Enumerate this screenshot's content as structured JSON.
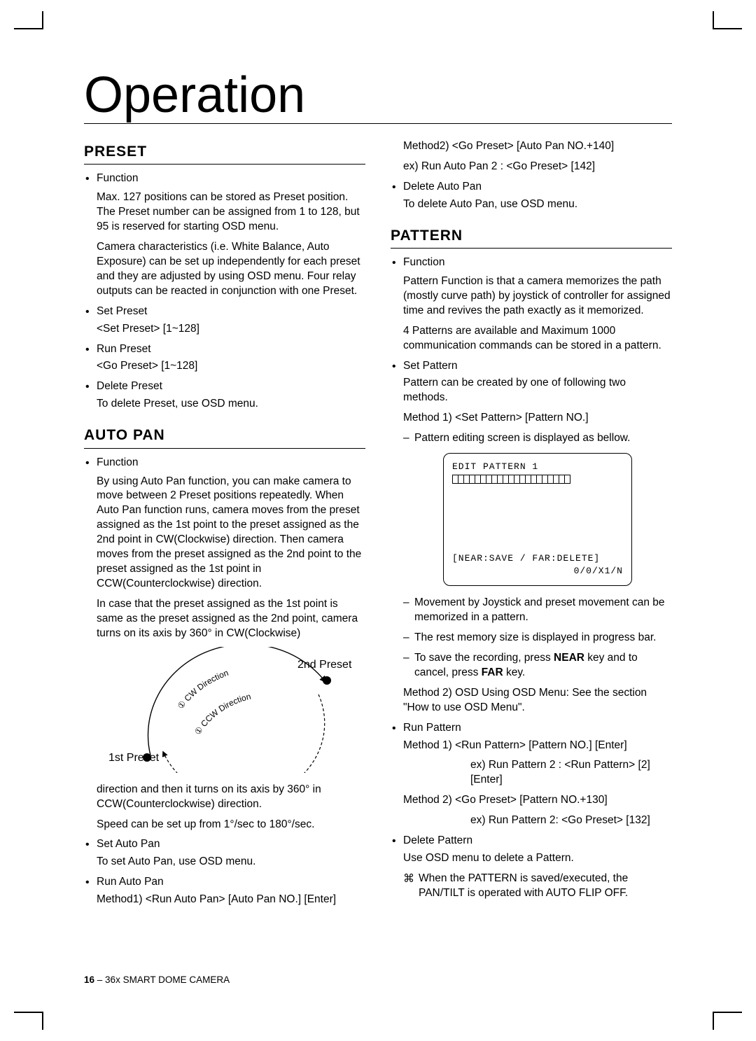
{
  "title": "Operation",
  "preset": {
    "heading": "PRESET",
    "function_label": "Function",
    "function_p1": "Max. 127 positions can be stored as Preset position. The Preset number can be assigned from 1 to 128, but 95 is reserved for starting OSD menu.",
    "function_p2": "Camera characteristics (i.e. White Balance, Auto Exposure) can be set up independently for each preset and they are adjusted by using OSD menu.  Four relay outputs can be reacted in conjunction with one Preset.",
    "set_label": "Set Preset",
    "set_cmd": "<Set Preset> [1~128]",
    "run_label": "Run Preset",
    "run_cmd": "<Go Preset> [1~128]",
    "delete_label": "Delete Preset",
    "delete_text": "To delete Preset, use OSD menu."
  },
  "autopan": {
    "heading": "AUTO PAN",
    "function_label": "Function",
    "function_p1": "By using Auto Pan function, you can make camera to move between 2 Preset positions repeatedly. When Auto Pan function runs, camera moves from the preset assigned as the 1st point to the preset assigned as the 2nd point in CW(Clockwise) direction. Then camera moves from the preset assigned as the 2nd point to the preset assigned as the 1st point in CCW(Counterclockwise) direction.",
    "function_p2": "In case that the preset assigned as the 1st point is same as the preset assigned as the 2nd point, camera turns on its axis by 360° in CW(Clockwise)",
    "diagram_cw": "① CW Direction",
    "diagram_ccw": "① CCW Direction",
    "diagram_1st": "1st Preset",
    "diagram_2nd": "2nd Preset",
    "function_p3": "direction and then it turns on its axis by 360° in CCW(Counterclockwise) direction.",
    "function_p4": "Speed can be set up from 1°/sec to 180°/sec.",
    "set_label": "Set Auto Pan",
    "set_text": "To set Auto Pan, use OSD menu.",
    "run_label": "Run Auto Pan",
    "run_m1": "Method1) <Run Auto Pan> [Auto Pan NO.] [Enter]",
    "run_m2": "Method2) <Go Preset> [Auto Pan NO.+140]",
    "run_m2_ex": "ex) Run Auto Pan 2 : <Go Preset> [142]",
    "delete_label": "Delete Auto Pan",
    "delete_text": "To delete Auto Pan, use OSD menu."
  },
  "pattern": {
    "heading": "PATTERN",
    "function_label": "Function",
    "function_p1": "Pattern Function is that a camera memorizes the path (mostly curve path) by joystick of controller for assigned time and revives the path exactly as it memorized.",
    "function_p2": "4 Patterns are available and Maximum 1000 communication commands can be stored in a pattern.",
    "set_label": "Set Pattern",
    "set_p1": "Pattern can be created by one of following two methods.",
    "set_m1": "Method 1) <Set Pattern> [Pattern NO.]",
    "set_m1_sub1": "Pattern editing screen is displayed as bellow.",
    "screen_title": "EDIT PATTERN 1",
    "screen_footer1": "[NEAR:SAVE / FAR:DELETE]",
    "screen_footer2": "0/0/X1/N",
    "set_m1_sub2": "Movement by Joystick and preset movement can be memorized in a pattern.",
    "set_m1_sub3": "The rest memory size is displayed in progress bar.",
    "set_m1_sub4_a": "To save the recording, press ",
    "set_m1_sub4_b": "NEAR",
    "set_m1_sub4_c": " key and to cancel, press ",
    "set_m1_sub4_d": "FAR",
    "set_m1_sub4_e": " key.",
    "set_m2": " Method 2) OSD Using OSD Menu: See the section \"How to use OSD Menu\".",
    "run_label": "Run Pattern",
    "run_m1": "Method 1) <Run Pattern> [Pattern NO.] [Enter]",
    "run_m1_ex": "ex) Run Pattern 2 : <Run Pattern> [2] [Enter]",
    "run_m2": "Method 2) <Go Preset> [Pattern NO.+130]",
    "run_m2_ex": "ex) Run Pattern 2: <Go Preset> [132]",
    "delete_label": "Delete Pattern",
    "delete_text": "Use OSD menu to delete a Pattern.",
    "note": "When the PATTERN is saved/executed, the PAN/TILT is operated with AUTO FLIP OFF."
  },
  "footer": {
    "page": "16",
    "sep": " – ",
    "product": "36x SMART DOME CAMERA"
  }
}
